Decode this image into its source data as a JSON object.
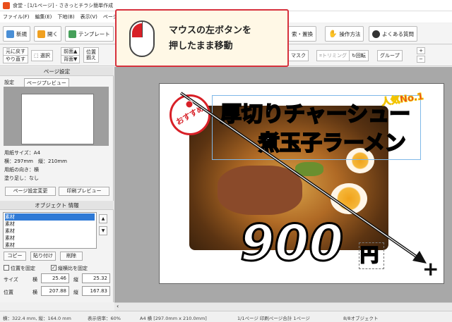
{
  "window": {
    "title": "食堂 - [1/1ページ] - さきっとチラシ簡単作成"
  },
  "menu": [
    "ファイル(F)",
    "編集(E)",
    "下地(B)",
    "表示(V)",
    "ページ(P)"
  ],
  "toolbar": {
    "new": "新規",
    "open": "開く",
    "template": "テンプレート",
    "search_replace": "索・置換",
    "operation": "操作方法",
    "faq": "よくある質問"
  },
  "toolbar2": {
    "undo": "元に戻す",
    "redo": "やり直す",
    "select": "選択",
    "front": "前面▲",
    "back": "背面▼",
    "align": "位置",
    "align2": "揃え",
    "mask": "マスク",
    "trimming": "トリミング",
    "rotate": "回転",
    "group": "グループ"
  },
  "page_settings": {
    "header": "ページ設定",
    "tab_settings": "設定",
    "tab_preview": "ページプレビュー",
    "paper_size": "用紙サイズ：A4",
    "dims": "横：297mm　縦：210mm",
    "orientation": "用紙の向き：横",
    "bleed": "塗り足し：なし",
    "change_btn": "ページ設定変更",
    "print_preview_btn": "印刷プレビュー"
  },
  "object_info": {
    "header": "オブジェクト 情報",
    "items": [
      "素材",
      "素材",
      "素材",
      "素材",
      "素材"
    ],
    "copy": "コピー",
    "paste": "貼り付け",
    "delete": "削除",
    "fix_pos": "位置を固定",
    "fix_ratio": "縦横比を固定",
    "size_label": "サイズ",
    "pos_label": "位置",
    "w_label": "横",
    "h_label": "縦",
    "size_w": "25.46",
    "size_h": "25.32",
    "pos_x": "207.88",
    "pos_y": "167.83"
  },
  "flyer": {
    "title_line1": "厚切りチャーシュー",
    "title_line2": "煮玉子ラーメン",
    "badge": "人気No.1",
    "stamp": "おすすめ",
    "price": "900",
    "yen": "円"
  },
  "callout": {
    "line1": "マウスの左ボタンを",
    "line2": "押したまま移動"
  },
  "status": {
    "coords": "横：322.4 mm, 縦：164.0 mm",
    "zoom": "表示倍率：60%",
    "paper": "A4 横 [297.0mm x 210.0mm]",
    "pages": "1/1ページ 印刷ページ合計 1ページ",
    "objects": "8/8オブジェクト"
  }
}
